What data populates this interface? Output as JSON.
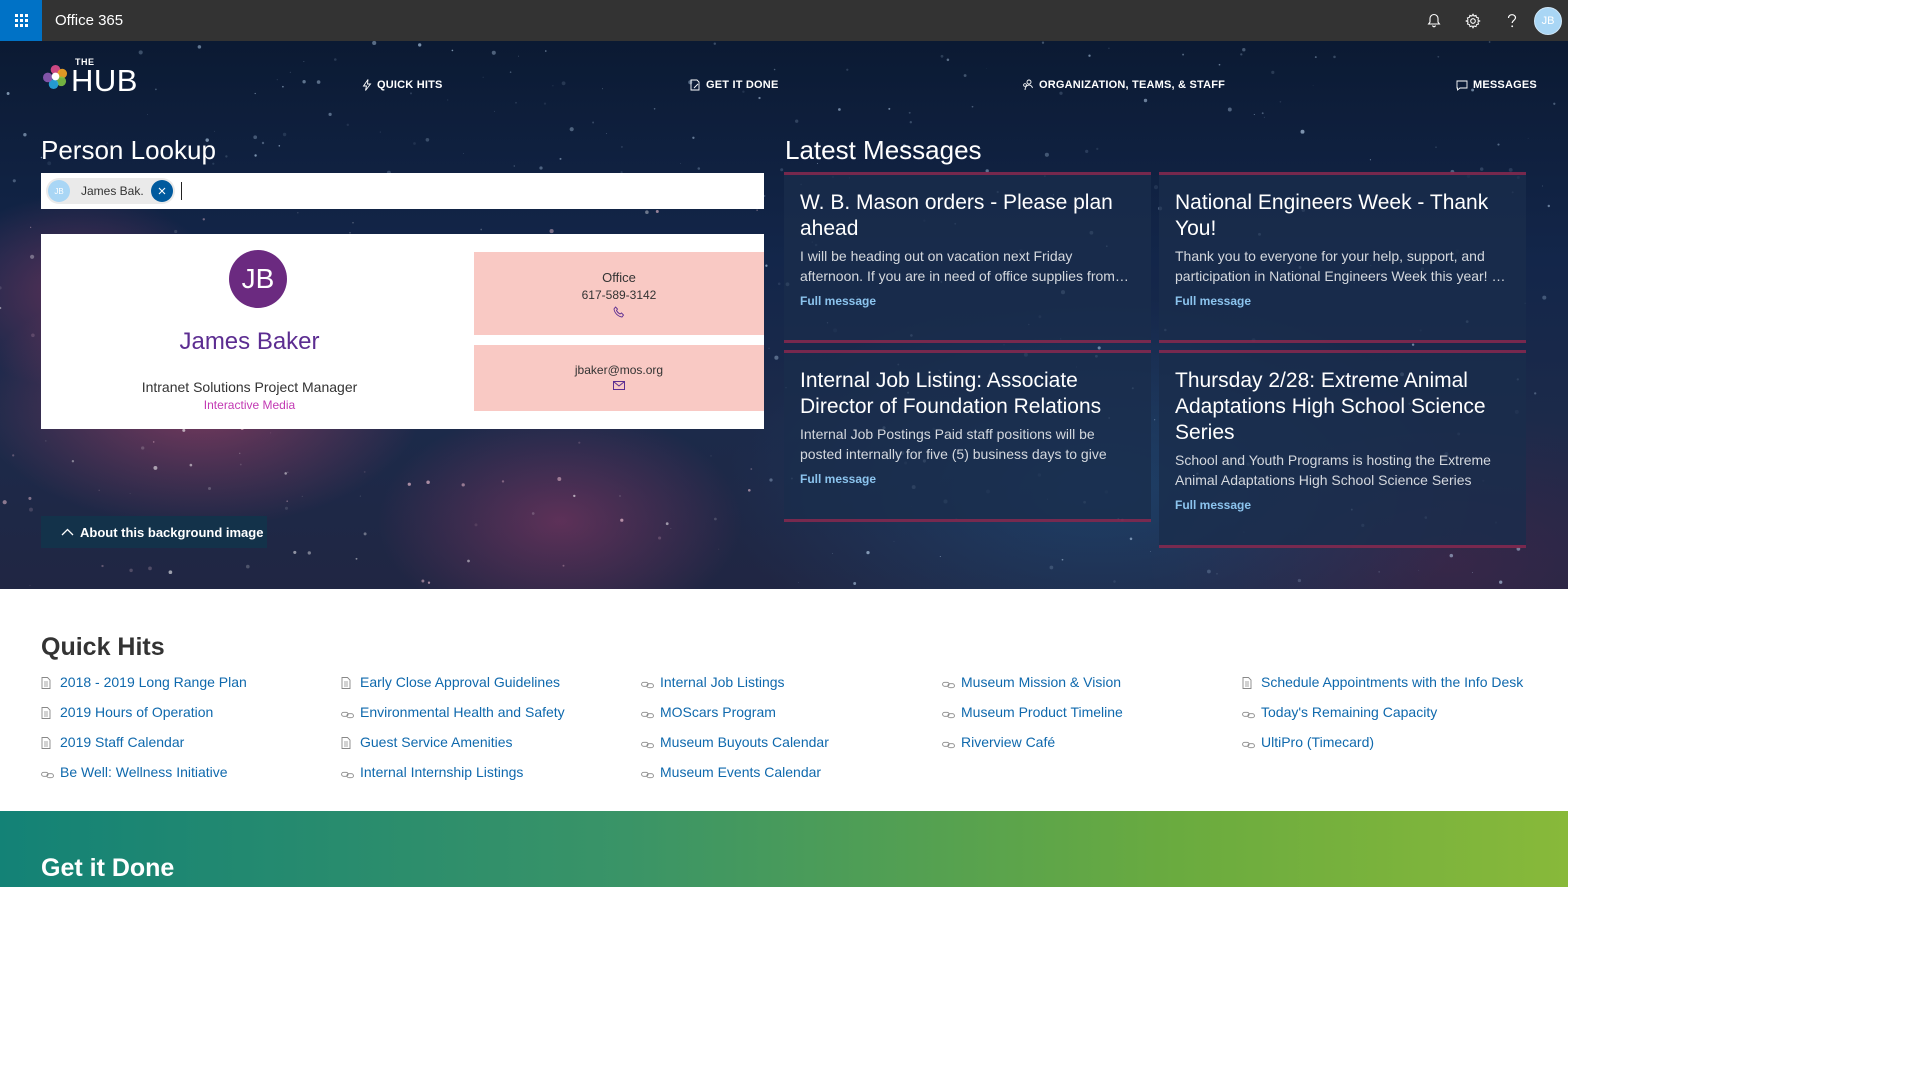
{
  "suite": {
    "app_title": "Office 365",
    "icons": [
      "waffle-icon",
      "bell-icon",
      "gear-icon",
      "help-icon"
    ],
    "user_initials": "JB"
  },
  "brand": {
    "logo_small": "THE",
    "logo_big": "HUB"
  },
  "nav": [
    {
      "label": "QUICK HITS",
      "icon": "lightning-icon"
    },
    {
      "label": "GET IT DONE",
      "icon": "document-edit-icon"
    },
    {
      "label": "ORGANIZATION, TEAMS, & STAFF",
      "icon": "people-icon"
    },
    {
      "label": "MESSAGES",
      "icon": "message-icon"
    }
  ],
  "person_lookup": {
    "title": "Person Lookup",
    "selected": {
      "initials": "JB",
      "name": "James Bak..."
    },
    "input_value": ""
  },
  "person_card": {
    "initials": "JB",
    "name": "James Baker",
    "job_title": "Intranet Solutions Project Manager",
    "department": "Interactive Media",
    "office_label": "Office",
    "office_phone": "617-589-3142",
    "email": "jbaker@mos.org"
  },
  "about_background": {
    "label": "About this background image"
  },
  "latest_messages": {
    "title": "Latest Messages",
    "link_label": "Full message",
    "items": [
      {
        "title": "W. B. Mason orders - Please plan ahead",
        "excerpt": "I will be heading out on vacation next Friday afternoon. If you are in need of office supplies from…"
      },
      {
        "title": "National Engineers Week - Thank You!",
        "excerpt": "Thank you to everyone for your help, support, and participation in National Engineers Week this year! …"
      },
      {
        "title": "Internal Job Listing: Associate Director of Foundation Relations",
        "excerpt": "Internal Job Postings Paid staff positions will be posted internally for five (5) business days to give int…"
      },
      {
        "title": "Thursday 2/28: Extreme Animal Adaptations High School Science Series",
        "excerpt": "School and Youth Programs is hosting the Extreme Animal Adaptations High School Science Series Thu…"
      }
    ]
  },
  "quick_hits": {
    "title": "Quick Hits",
    "columns": [
      [
        {
          "label": "2018 - 2019 Long Range Plan",
          "icon": "document-icon"
        },
        {
          "label": "2019 Hours of Operation",
          "icon": "document-icon"
        },
        {
          "label": "2019 Staff Calendar",
          "icon": "document-icon"
        },
        {
          "label": "Be Well: Wellness Initiative",
          "icon": "link-icon"
        }
      ],
      [
        {
          "label": "Early Close Approval Guidelines",
          "icon": "document-icon"
        },
        {
          "label": "Environmental Health and Safety",
          "icon": "link-icon"
        },
        {
          "label": "Guest Service Amenities",
          "icon": "document-icon"
        },
        {
          "label": "Internal Internship Listings",
          "icon": "link-icon"
        }
      ],
      [
        {
          "label": "Internal Job Listings",
          "icon": "link-icon"
        },
        {
          "label": "MOScars Program",
          "icon": "link-icon"
        },
        {
          "label": "Museum Buyouts Calendar",
          "icon": "link-icon"
        },
        {
          "label": "Museum Events Calendar",
          "icon": "link-icon"
        }
      ],
      [
        {
          "label": "Museum Mission & Vision",
          "icon": "link-icon"
        },
        {
          "label": "Museum Product Timeline",
          "icon": "link-icon"
        },
        {
          "label": "Riverview Café",
          "icon": "link-icon"
        }
      ],
      [
        {
          "label": "Schedule Appointments with the Info Desk",
          "icon": "document-icon"
        },
        {
          "label": "Today's Remaining Capacity",
          "icon": "link-icon"
        },
        {
          "label": "UltiPro (Timecard)",
          "icon": "link-icon"
        }
      ]
    ]
  },
  "get_it_done": {
    "title": "Get it Done"
  },
  "colors": {
    "suite_bar": "#333333",
    "waffle": "#0072c6",
    "name_purple": "#5c2d91",
    "dept_pink": "#c239b3",
    "contact_bg": "#f9c9c4",
    "link_blue": "#0f69ad",
    "message_link": "#8cc4ee"
  }
}
